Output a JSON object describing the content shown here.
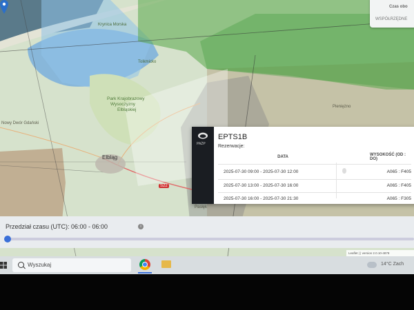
{
  "map": {
    "labels": {
      "park_line1": "Park Krajobrazowy",
      "park_line2": "Wysoczyzny",
      "park_line3": "Elbląskiej",
      "city": "Elbląg",
      "town_north": "Tolkmicko",
      "town_coast": "Krynica Morska",
      "town_east": "Pieniężno",
      "town_south": "Pasłęk",
      "town_west": "Nowy Dwór Gdański",
      "road": "S22"
    },
    "attribution": "Leaflet | | version 2.0.10-4878"
  },
  "corner_panel": {
    "time_label": "Czas obo",
    "link": "WSPÓŁRZĘDNE"
  },
  "popup": {
    "logo_text": "PAŻP",
    "airspace_code": "EPTS1B",
    "reservations_label": "Rezerwacje:",
    "columns": [
      "DATA",
      "WYSOKOŚĆ (OD : DO)"
    ],
    "rows": [
      {
        "date": "2025-07-30 09:00 - 2025-07-30 12:00",
        "altitude": "A065 : F405"
      },
      {
        "date": "2025-07-30 13:00 - 2025-07-30 16:00",
        "altitude": "A065 : F405"
      },
      {
        "date": "2025-07-30 16:00 - 2025-07-30 21:30",
        "altitude": "A065 : F305"
      }
    ]
  },
  "timebar": {
    "label": "Przedział czasu (UTC): 06:00 - 06:00",
    "info_icon": "info-icon"
  },
  "taskbar": {
    "search_placeholder": "Wyszukaj",
    "temperature": "14°C Zach"
  },
  "colors": {
    "airspace_green": "#5aa84a",
    "water_blue": "#7fb2dc",
    "popup_dark": "#1a1d22",
    "slider_accent": "#3a6fd8"
  }
}
